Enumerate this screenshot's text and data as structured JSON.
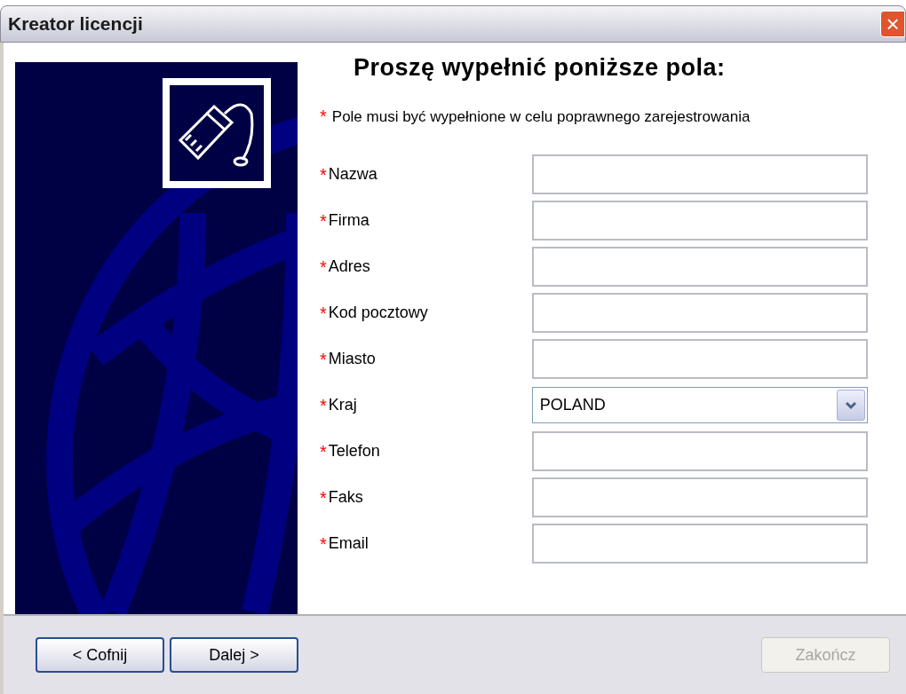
{
  "window": {
    "title": "Kreator licencji",
    "close": "×"
  },
  "heading": "Proszę wypełnić poniższe pola:",
  "note": {
    "mark": "*",
    "text": "Pole musi być wypełnione w celu poprawnego zarejestrowania"
  },
  "fields": [
    {
      "kind": "text",
      "mark": "*",
      "label": "Nazwa"
    },
    {
      "kind": "text",
      "mark": "*",
      "label": "Firma"
    },
    {
      "kind": "text",
      "mark": "*",
      "label": "Adres"
    },
    {
      "kind": "text",
      "mark": "*",
      "label": "Kod pocztowy"
    },
    {
      "kind": "text",
      "mark": "*",
      "label": "Miasto"
    },
    {
      "kind": "combo",
      "mark": "*",
      "label": "Kraj",
      "value": "POLAND"
    },
    {
      "kind": "text",
      "mark": "*",
      "label": "Telefon"
    },
    {
      "kind": "text",
      "mark": "*",
      "label": "Faks"
    },
    {
      "kind": "text",
      "mark": "*",
      "label": "Email"
    }
  ],
  "buttons": [
    {
      "label": "< Cofnij",
      "disabled": false
    },
    {
      "label": "Dalej >",
      "disabled": false
    },
    {
      "label": "Zakończ",
      "disabled": true
    }
  ]
}
